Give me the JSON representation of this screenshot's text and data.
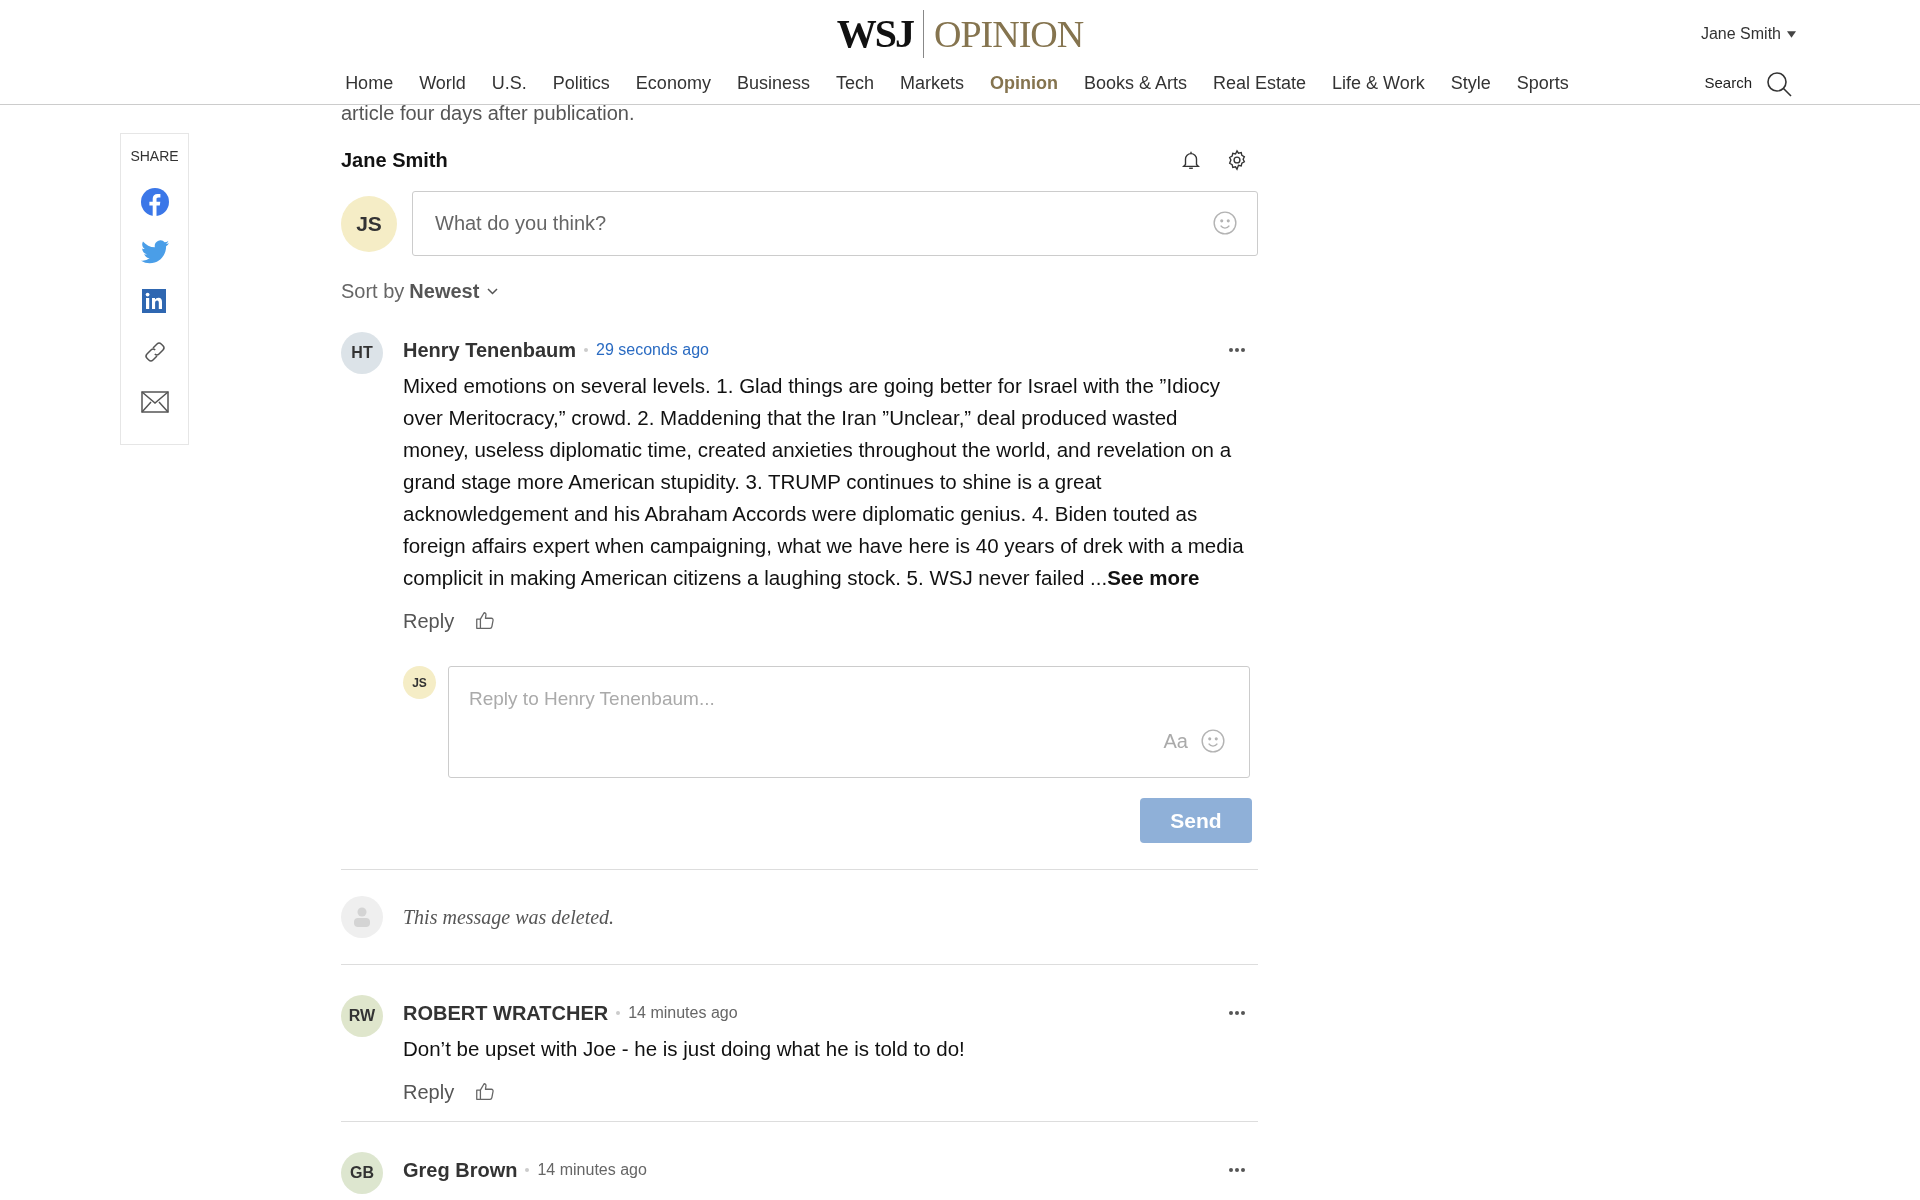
{
  "header": {
    "logo": {
      "primary": "WSJ",
      "secondary": "OPINION"
    },
    "user": "Jane Smith",
    "search": "Search",
    "nav": [
      {
        "label": "Home",
        "selected": false
      },
      {
        "label": "World",
        "selected": false
      },
      {
        "label": "U.S.",
        "selected": false
      },
      {
        "label": "Politics",
        "selected": false
      },
      {
        "label": "Economy",
        "selected": false
      },
      {
        "label": "Business",
        "selected": false
      },
      {
        "label": "Tech",
        "selected": false
      },
      {
        "label": "Markets",
        "selected": false
      },
      {
        "label": "Opinion",
        "selected": true
      },
      {
        "label": "Books & Arts",
        "selected": false
      },
      {
        "label": "Real Estate",
        "selected": false
      },
      {
        "label": "Life & Work",
        "selected": false
      },
      {
        "label": "Style",
        "selected": false
      },
      {
        "label": "Sports",
        "selected": false
      }
    ]
  },
  "share": {
    "label": "SHARE",
    "items": [
      {
        "kind": "facebook"
      },
      {
        "kind": "twitter"
      },
      {
        "kind": "linkedin"
      },
      {
        "kind": "link"
      },
      {
        "kind": "email"
      }
    ]
  },
  "article_tail": "article four days after publication.",
  "comments": {
    "user": "Jane Smith",
    "initials": "JS",
    "placeholder": "What do you think?",
    "sort_label": "Sort by",
    "sort_value": "Newest",
    "list": [
      {
        "kind": "comment",
        "initials": "HT",
        "color": "#dce3e8",
        "author": "Henry Tenenbaum",
        "time": "29 seconds ago",
        "recent": true,
        "body": "Mixed emotions on several levels. 1. Glad things are going better for Israel with the ”Idiocy over Meritocracy,” crowd. 2. Maddening that the Iran ”Unclear,” deal produced wasted money, useless diplomatic time, created anxieties throughout the world,  and revelation on a grand stage more American stupidity. 3. TRUMP continues to shine is a great acknowledgement and his Abraham Accords were diplomatic genius. 4. Biden touted as foreign affairs expert when campaigning, what we have here is 40 years of drek with a media complicit in making American citizens a laughing stock. 5. WSJ never failed ...",
        "see_more": "See more",
        "reply": "Reply",
        "reply_box": {
          "initials": "JS",
          "placeholder": "Reply to Henry Tenenbaum...",
          "format": "Aa",
          "send": "Send",
          "disabled": true
        }
      },
      {
        "kind": "deleted",
        "text": "This message was deleted."
      },
      {
        "kind": "comment",
        "initials": "RW",
        "color": "#dfe6cc",
        "author": "ROBERT WRATCHER",
        "time": "14 minutes ago",
        "recent": false,
        "body": "Don’t be upset with Joe - he is just doing what he is told to do!",
        "reply": "Reply"
      },
      {
        "kind": "comment",
        "initials": "GB",
        "color": "#dde6cf",
        "author": "Greg Brown",
        "time": "14 minutes ago",
        "recent": false
      }
    ]
  }
}
